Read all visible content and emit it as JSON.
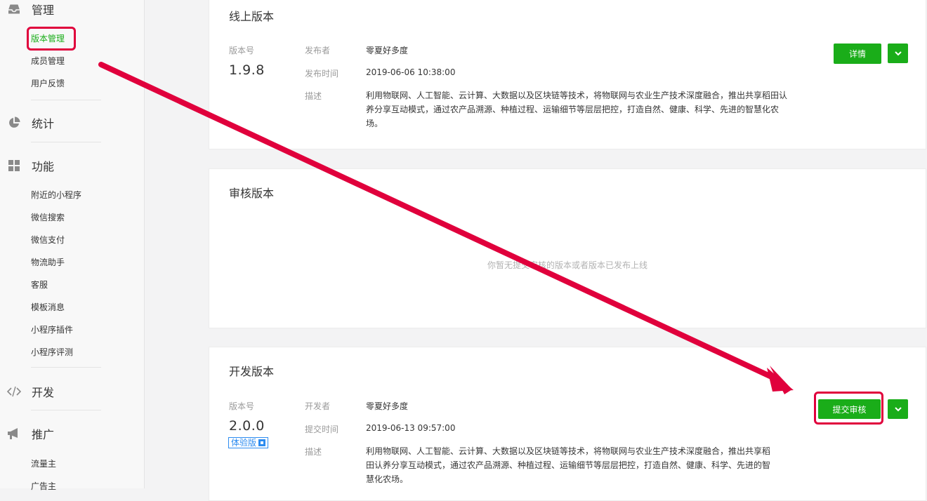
{
  "sidebar": {
    "manage": {
      "label": "管理",
      "items": [
        {
          "label": "版本管理",
          "active": true
        },
        {
          "label": "成员管理"
        },
        {
          "label": "用户反馈"
        }
      ]
    },
    "stats": {
      "label": "统计"
    },
    "features": {
      "label": "功能",
      "items": [
        {
          "label": "附近的小程序"
        },
        {
          "label": "微信搜索"
        },
        {
          "label": "微信支付"
        },
        {
          "label": "物流助手"
        },
        {
          "label": "客服"
        },
        {
          "label": "模板消息"
        },
        {
          "label": "小程序插件"
        },
        {
          "label": "小程序评测"
        }
      ]
    },
    "dev": {
      "label": "开发"
    },
    "promo": {
      "label": "推广",
      "items": [
        {
          "label": "流量主"
        },
        {
          "label": "广告主"
        }
      ]
    }
  },
  "online": {
    "title": "线上版本",
    "version_label": "版本号",
    "version": "1.9.8",
    "publisher_label": "发布者",
    "publisher": "零夏好多度",
    "time_label": "发布时间",
    "time": "2019-06-06 10:38:00",
    "desc_label": "描述",
    "desc_lines": [
      "利用物联网、人工智能、云计算、大数据以及区块链等技术，将物联网与农业生产技术深度融合，推出共享稻田认",
      "养分享互动模式，通过农产品溯源、种植过程、运输细节等层层把控，打造自然、健康、科学、先进的智慧化农",
      "场。"
    ],
    "detail_button": "详情"
  },
  "review": {
    "title": "审核版本",
    "empty": "你暂无提交审核的版本或者版本已发布上线"
  },
  "dev_version": {
    "title": "开发版本",
    "version_label": "版本号",
    "version": "2.0.0",
    "tag": "体验版",
    "developer_label": "开发者",
    "developer": "零夏好多度",
    "time_label": "提交时间",
    "time": "2019-06-13 09:57:00",
    "desc_label": "描述",
    "desc_lines": [
      "利用物联网、人工智能、云计算、大数据以及区块链等技术，将物联网与农业生产技术深度融合，推出共享稻",
      "田认养分享互动模式，通过农产品溯源、种植过程、运输细节等层层把控，打造自然、健康、科学、先进的智",
      "慧化农场。"
    ],
    "submit_button": "提交审核"
  },
  "colors": {
    "accent": "#1aad19",
    "annotation": "#e0003c",
    "tag": "#2d8cf0"
  },
  "icons": [
    "inbox-icon",
    "pie-chart-icon",
    "grid-icon",
    "code-icon",
    "megaphone-icon",
    "chevron-down-icon",
    "qr-code-icon"
  ]
}
